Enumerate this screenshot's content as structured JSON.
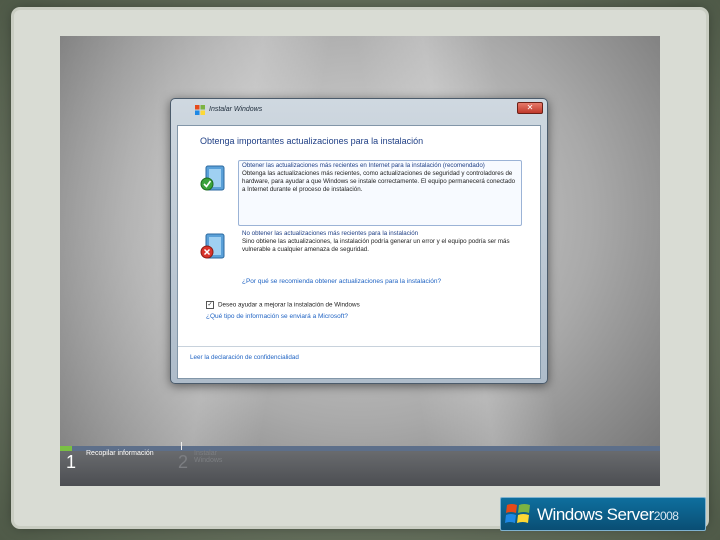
{
  "installer": {
    "window_title": "Instalar Windows",
    "close_label": "✕",
    "heading": "Obtenga importantes actualizaciones para la instalación",
    "options": [
      {
        "title": "Obtener las actualizaciones más recientes en Internet para la instalación (recomendado)",
        "description": "Obtenga las actualizaciones más recientes, como actualizaciones de seguridad y controladores de hardware, para ayudar a que Windows se instale correctamente. El equipo permanecerá conectado a Internet durante el proceso de instalación.",
        "icon": "shield-check-icon"
      },
      {
        "title": "No obtener las actualizaciones más recientes para la instalación",
        "description": "Sino obtiene las actualizaciones, la instalación podría generar un error y el equipo podría ser más vulnerable a cualquier amenaza de seguridad.",
        "icon": "shield-x-icon"
      }
    ],
    "why_link": "¿Por qué se recomienda obtener actualizaciones para la instalación?",
    "checkbox_label": "Deseo ayudar a mejorar la instalación de Windows",
    "checkbox_checked": "✓",
    "info_link": "¿Qué tipo de información se enviará a Microsoft?",
    "privacy_link": "Leer la declaración de confidencialidad"
  },
  "progress": {
    "fraction": 0.02,
    "steps": [
      {
        "number": "1",
        "label": "Recopilar información"
      },
      {
        "number": "2",
        "label": "Instalar Windows"
      }
    ]
  },
  "brand": {
    "name": "Windows Server",
    "year": "2008"
  },
  "colors": {
    "heading_blue": "#1f3f85",
    "link_blue": "#1f63c3",
    "progress_green": "#7ac043"
  }
}
